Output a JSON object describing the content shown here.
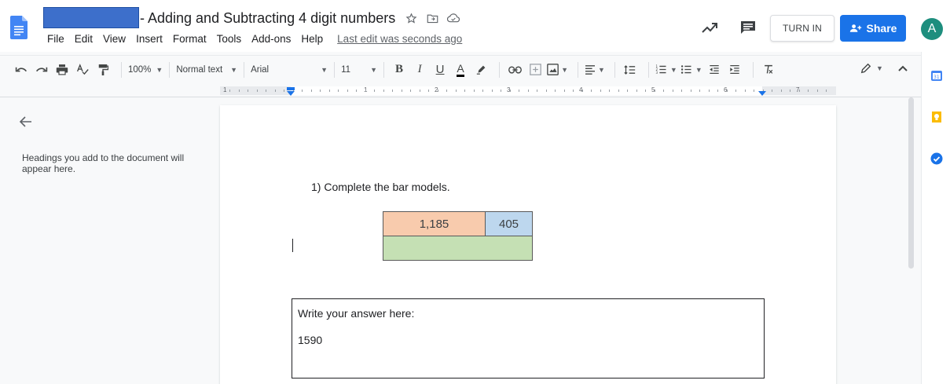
{
  "titlebar": {
    "doc_title": "- Adding and Subtracting 4 digit numbers",
    "last_edit": "Last edit was seconds ago",
    "turn_in": "TURN IN",
    "share": "Share",
    "avatar_initial": "A"
  },
  "menu": [
    "File",
    "Edit",
    "View",
    "Insert",
    "Format",
    "Tools",
    "Add-ons",
    "Help"
  ],
  "toolbar": {
    "zoom": "100%",
    "style": "Normal text",
    "font": "Arial",
    "font_size": "11",
    "bold": "B",
    "italic": "I",
    "underline": "U",
    "text_color": "A"
  },
  "ruler": {
    "numbers": [
      "1",
      "1",
      "2",
      "3",
      "4",
      "5",
      "6",
      "7"
    ]
  },
  "outline": {
    "placeholder": "Headings you add to the document will appear here."
  },
  "document": {
    "question": "1)  Complete the bar models.",
    "bar_model": {
      "part_a": "1,185",
      "part_b": "405",
      "whole": "",
      "colors": {
        "part_a": "#f8cbad",
        "part_b": "#bdd7ee",
        "whole": "#c5e0b4"
      }
    },
    "answer_label": "Write your answer here:",
    "answer_value": "1590"
  },
  "colors": {
    "accent": "#1a73e8",
    "avatar": "#1e8e7e",
    "redaction": "#3d6fcb"
  },
  "icons": [
    "docs-logo-icon",
    "star-icon",
    "move-folder-icon",
    "cloud-saved-icon",
    "activity-trend-icon",
    "comments-icon",
    "share-people-icon",
    "undo-icon",
    "redo-icon",
    "print-icon",
    "spellcheck-icon",
    "paint-format-icon",
    "highlight-icon",
    "link-icon",
    "insert-comment-icon",
    "insert-image-icon",
    "align-icon",
    "line-spacing-icon",
    "numbered-list-icon",
    "bulleted-list-icon",
    "decrease-indent-icon",
    "increase-indent-icon",
    "clear-formatting-icon",
    "editing-pencil-icon",
    "collapse-icon",
    "back-arrow-icon",
    "calendar-icon",
    "keep-icon",
    "tasks-icon"
  ]
}
